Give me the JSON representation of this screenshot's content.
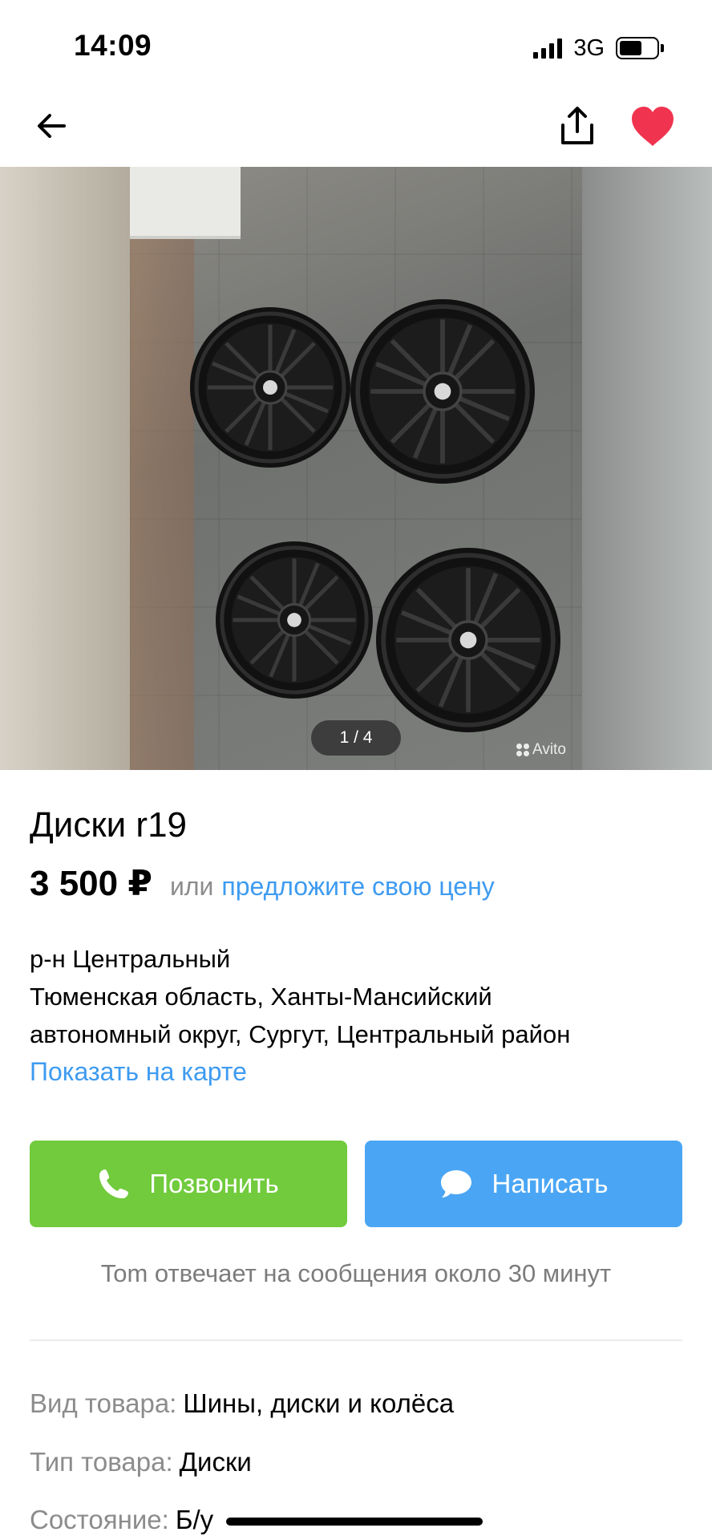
{
  "status": {
    "time": "14:09",
    "network": "3G",
    "battery_level": 0.62
  },
  "nav": {
    "back_icon": "arrow-left-icon",
    "share_icon": "share-icon",
    "favorite_icon": "heart-icon",
    "favorite_color": "#f0344f"
  },
  "gallery": {
    "counter": "1 / 4",
    "watermark": "Avito"
  },
  "listing": {
    "title": "Диски r19",
    "price": "3 500 ₽",
    "price_or": "или",
    "offer_link": "предложите свою цену",
    "district": "р-н Центральный",
    "address_line1": "Тюменская область, Ханты-Мансийский",
    "address_line2": "автономный округ, Сургут, Центральный район",
    "map_link": "Показать на карте"
  },
  "actions": {
    "call_label": "Позвонить",
    "call_icon": "phone-icon",
    "call_color": "#71cb3c",
    "message_label": "Написать",
    "message_icon": "chat-bubble-icon",
    "message_color": "#4aa6f4"
  },
  "seller_note": "Tom отвечает на сообщения около 30 минут",
  "params": [
    {
      "label": "Вид товара:",
      "value": "Шины, диски и колёса"
    },
    {
      "label": "Тип товара:",
      "value": "Диски"
    },
    {
      "label": "Состояние:",
      "value": "Б/у"
    }
  ],
  "colors": {
    "link": "#3e9bf0",
    "muted": "#8c8c8c"
  }
}
